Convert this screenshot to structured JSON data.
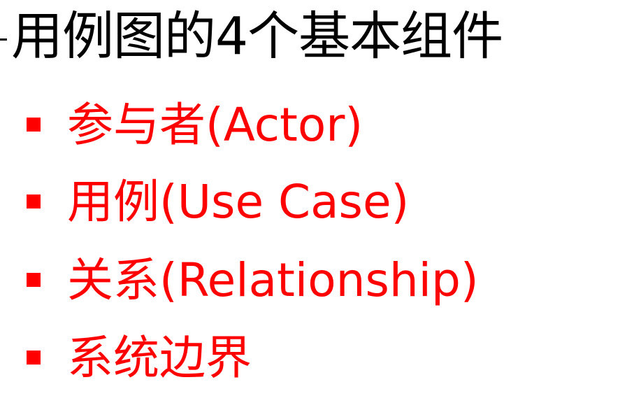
{
  "slide": {
    "title": "用例图的4个基本组件",
    "title_color": "#000000",
    "bullet_color": "#ff0000",
    "items": [
      {
        "label": "参与者(Actor)"
      },
      {
        "label": "用例(Use Case)"
      },
      {
        "label": "关系(Relationship)"
      },
      {
        "label": "系统边界"
      }
    ]
  }
}
